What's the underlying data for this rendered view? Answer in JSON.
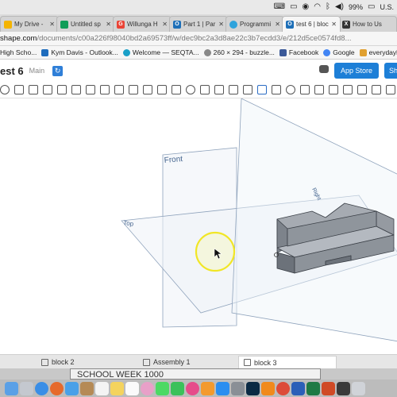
{
  "menubar": {
    "items": [
      {
        "icon": "keyboard-icon"
      },
      {
        "icon": "screen-mirror-icon"
      },
      {
        "icon": "record-icon"
      },
      {
        "icon": "wifi-icon"
      },
      {
        "icon": "bluetooth-icon"
      },
      {
        "icon": "volume-icon"
      },
      {
        "icon": "battery-icon"
      }
    ],
    "battery_text": "99%",
    "flag_label": "U.S."
  },
  "browser": {
    "tabs": [
      {
        "label": "My Drive -",
        "icon": "drive-icon",
        "color": "#f4b400",
        "active": false
      },
      {
        "label": "Untitled sp",
        "icon": "sheets-icon",
        "color": "#0f9d58",
        "active": false
      },
      {
        "label": "Willunga H",
        "icon": "google-icon",
        "color": "#ea4335",
        "active": false
      },
      {
        "label": "Part 1 | Par",
        "icon": "onshape-icon",
        "color": "#1d6fb8",
        "active": false
      },
      {
        "label": "Programmi",
        "icon": "globe-icon",
        "color": "#2ea3dc",
        "active": false
      },
      {
        "label": "test 6 | bloc",
        "icon": "onshape-icon",
        "color": "#1d6fb8",
        "active": true
      },
      {
        "label": "How to Us",
        "icon": "x-icon",
        "color": "#333333",
        "active": false
      }
    ],
    "address": {
      "host": "shape.com",
      "path": "/documents/c00a226f98040bd2a69573ff/w/dec9bc2a3d8ae22c3b7ecdd3/e/212d5ce0574fd8..."
    },
    "bookmarks": [
      {
        "label": "High Scho...",
        "icon": "school-icon",
        "color": "#cc4444"
      },
      {
        "label": "Kym Davis - Outlook...",
        "icon": "outlook-icon",
        "color": "#1f6dbd"
      },
      {
        "label": "Welcome — SEQTA...",
        "icon": "seqta-icon",
        "color": "#1aa0c8"
      },
      {
        "label": "260 × 294 - buzzle...",
        "icon": "search-icon",
        "color": "#666666"
      },
      {
        "label": "Facebook",
        "icon": "facebook-icon",
        "color": "#3b5998"
      },
      {
        "label": "Google",
        "icon": "google-icon",
        "color": "#4285f4"
      },
      {
        "label": "everydayher...",
        "icon": "bookmark-icon",
        "color": "#e0a030"
      }
    ]
  },
  "onshape": {
    "doc_title": "est 6",
    "branch": "Main",
    "app_store_label": "App Store",
    "share_label": "Sh",
    "accent_color": "#1d7fd7"
  },
  "viewport": {
    "plane_labels": {
      "front": "Front",
      "top": "Top",
      "right": "Right"
    }
  },
  "bottom_tabs": [
    {
      "label": "block 2",
      "active": false
    },
    {
      "label": "Assembly 1",
      "active": false
    },
    {
      "label": "block 3",
      "active": true
    }
  ],
  "background_window": {
    "text": "SCHOOL WEEK    1000"
  },
  "dock": {
    "apps": [
      "finder-icon",
      "launchpad-icon",
      "safari-icon",
      "firefox-icon",
      "mail-icon",
      "contacts-icon",
      "calendar-icon",
      "notes-icon",
      "reminders-icon",
      "photos-icon",
      "messages-icon",
      "facetime-icon",
      "itunes-icon",
      "ibooks-icon",
      "appstore-icon",
      "preferences-icon",
      "photoshop-icon",
      "vlc-icon",
      "chrome-icon",
      "word-icon",
      "excel-icon",
      "powerpoint-icon",
      "screenflow-icon",
      "trash-icon"
    ]
  }
}
